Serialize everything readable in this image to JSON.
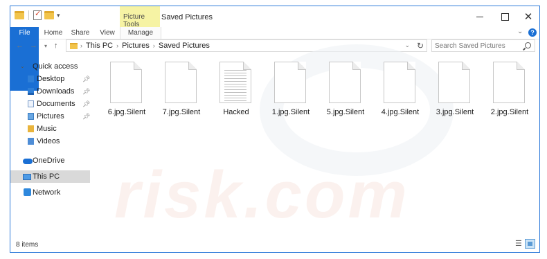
{
  "window": {
    "title": "Saved Pictures",
    "contextual_group": "Picture Tools"
  },
  "ribbon": {
    "tabs": [
      "File",
      "Home",
      "Share",
      "View",
      "Manage"
    ]
  },
  "address": {
    "crumbs": [
      "This PC",
      "Pictures",
      "Saved Pictures"
    ]
  },
  "search": {
    "placeholder": "Search Saved Pictures"
  },
  "nav": {
    "quick_access": "Quick access",
    "items": [
      {
        "label": "Desktop",
        "pinned": true
      },
      {
        "label": "Downloads",
        "pinned": true
      },
      {
        "label": "Documents",
        "pinned": true
      },
      {
        "label": "Pictures",
        "pinned": true
      },
      {
        "label": "Music",
        "pinned": false
      },
      {
        "label": "Videos",
        "pinned": false
      }
    ],
    "onedrive": "OneDrive",
    "this_pc": "This PC",
    "network": "Network"
  },
  "files": [
    {
      "name": "6.jpg.Silent",
      "kind": "blank"
    },
    {
      "name": "7.jpg.Silent",
      "kind": "blank"
    },
    {
      "name": "Hacked",
      "kind": "text"
    },
    {
      "name": "1.jpg.Silent",
      "kind": "blank"
    },
    {
      "name": "5.jpg.Silent",
      "kind": "blank"
    },
    {
      "name": "4.jpg.Silent",
      "kind": "blank"
    },
    {
      "name": "3.jpg.Silent",
      "kind": "blank"
    },
    {
      "name": "2.jpg.Silent",
      "kind": "blank"
    }
  ],
  "status": {
    "item_count": "8 items"
  },
  "watermark": "risk.com",
  "colors": {
    "accent": "#1a6fd4",
    "contextual_tab": "#f6f3a4",
    "selected_nav": "#d9d9d9"
  }
}
